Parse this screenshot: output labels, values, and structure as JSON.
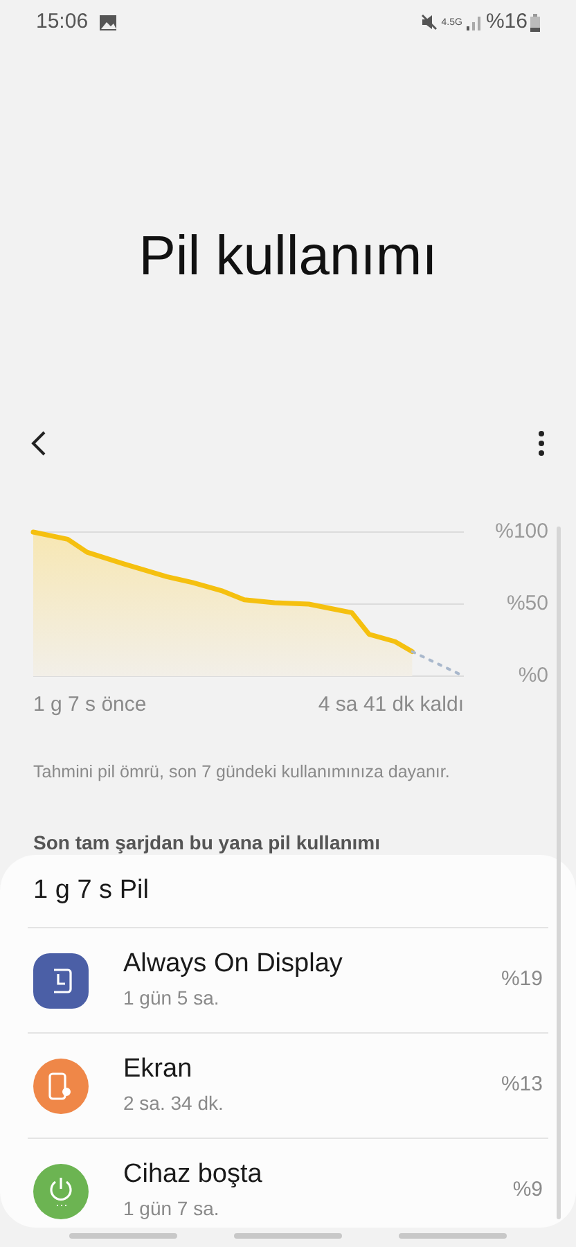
{
  "status_bar": {
    "time": "15:06",
    "network": "4.5G",
    "battery": "%16"
  },
  "title": "Pil kullanımı",
  "chart": {
    "level_labels": [
      "%100",
      "%50",
      "%0"
    ]
  },
  "chart_footer": {
    "start": "1 g 7 s önce",
    "end": "4 sa 41 dk kaldı"
  },
  "note": "Tahmini pil ömrü, son 7 gündeki kullanımınıza dayanır.",
  "section_title": "Son tam şarjdan bu yana pil kullanımı",
  "card": {
    "header": "1 g 7 s Pil",
    "items": [
      {
        "kind": "clock",
        "color": "#4b5fa6",
        "name": "Always On Display",
        "duration": "1 gün 5 sa.",
        "percent": "%19"
      },
      {
        "kind": "screen",
        "color": "#ef8748",
        "name": "Ekran",
        "duration": "2 sa. 34 dk.",
        "percent": "%13"
      },
      {
        "kind": "power",
        "color": "#6cb452",
        "name": "Cihaz boşta",
        "duration": "1 gün 7 sa.",
        "percent": "%9"
      }
    ]
  }
}
